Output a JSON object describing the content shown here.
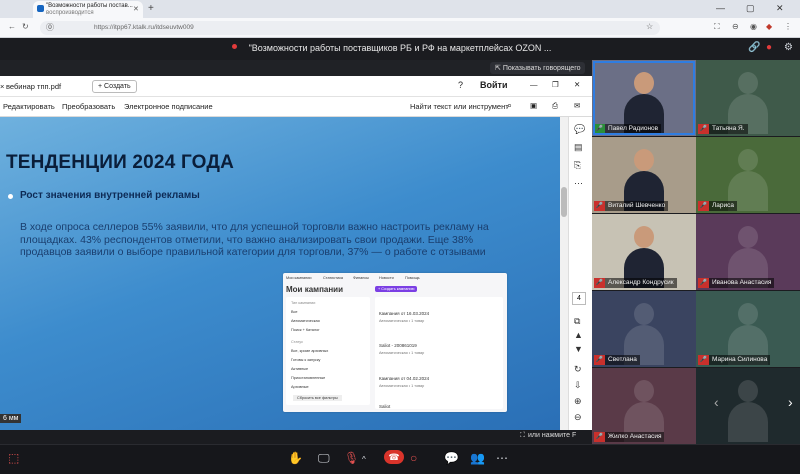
{
  "browser": {
    "tab_title": "\"Возможности работы постав...",
    "tab_subtitle": "воспроизводится",
    "url": "https://itpp67.ktalk.ru/itdseuvtw009"
  },
  "meeting": {
    "title": "\"Возможности работы поставщиков РБ и РФ на маркетплейсах OZON ...",
    "show_speaker_label": "Показывать говорящего",
    "exit_fullscreen_label": "или нажмите F"
  },
  "pdf": {
    "file_name": "вебинар тпп.pdf",
    "create_label": "Создать",
    "login_label": "Войти",
    "menu": [
      "Редактировать",
      "Преобразовать",
      "Электронное подписание"
    ],
    "search_label": "Найти текст или инструмент",
    "page_number": "4",
    "zoom_label": "6 мм"
  },
  "slide": {
    "title": "ТЕНДЕНЦИИ 2024 ГОДА",
    "bullet_heading": "Рост значения внутренней рекламы",
    "body": "В ходе опроса селлеров 55% заявили, что для успешной торговли важно настроить рекламу на площадках. 43% респондентов отметили, что важно анализировать свои продажи. Еще 38% продавцов заявили о выборе правильной категории для торговли, 37% — о работе с отзывами",
    "mini": {
      "tabs": [
        "Мои кампании",
        "Статистика",
        "Финансы",
        "Новости",
        "Помощь"
      ],
      "header": "Мои кампании",
      "create_btn": "+ Создать кампанию",
      "filter_left": [
        "Тип кампании",
        "Все",
        "Автоматическая",
        "Поиск + Каталог",
        "Статус",
        "Все, кроме архивных",
        "Готовы к запуску",
        "Активные",
        "Приостановленные",
        "Архивные"
      ],
      "reset_btn": "Сбросить все фильтры",
      "campaigns": [
        {
          "name": "Кампания от 16.03.2024",
          "type": "Автоматическая • 1 товар"
        },
        {
          "name": "Saliot - 200861019",
          "type": "Автоматическая • 1 товар"
        },
        {
          "name": "Кампания от 04.02.2024",
          "type": "Автоматическая • 1 товар"
        },
        {
          "name": "Saliot",
          "type": ""
        }
      ]
    }
  },
  "participants": [
    {
      "name": "Павел Радионов",
      "mic_on": true,
      "bg": "#6b6f86",
      "has_video": true
    },
    {
      "name": "Татьяна Я.",
      "mic_on": false,
      "bg": "#3f5a4a",
      "has_video": false
    },
    {
      "name": "Виталий Шевченко",
      "mic_on": false,
      "bg": "#a89c8a",
      "has_video": true
    },
    {
      "name": "Лариса",
      "mic_on": false,
      "bg": "#4a6a3a",
      "has_video": false
    },
    {
      "name": "Александр Кондрусик",
      "mic_on": false,
      "bg": "#c7c2b4",
      "has_video": true
    },
    {
      "name": "Иванова Анастасия",
      "mic_on": false,
      "bg": "#5a3a5a",
      "has_video": false
    },
    {
      "name": "Светлана",
      "mic_on": false,
      "bg": "#3a4460",
      "has_video": false
    },
    {
      "name": "Марина Силинова",
      "mic_on": false,
      "bg": "#3a5a52",
      "has_video": false
    },
    {
      "name": "Жилко Анастасия",
      "mic_on": false,
      "bg": "#5a3a48",
      "has_video": false
    },
    {
      "name": "",
      "mic_on": false,
      "bg": "#1f2a2d",
      "has_video": false
    }
  ]
}
